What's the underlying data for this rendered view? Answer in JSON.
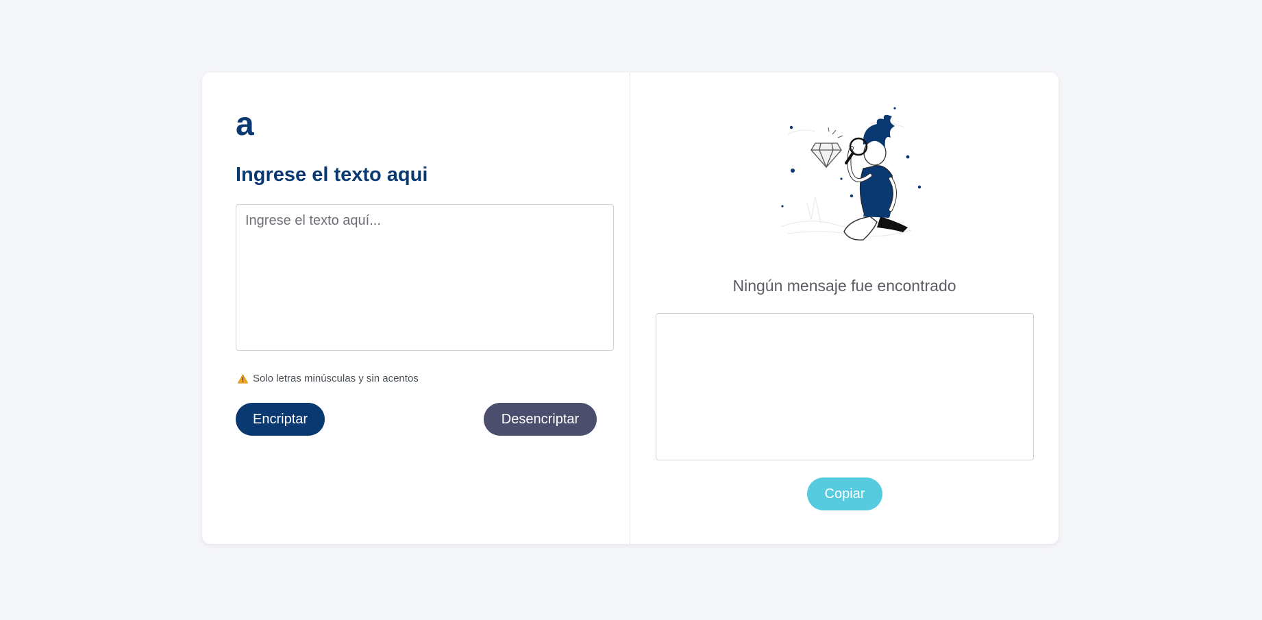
{
  "app": {
    "logo_text": "a",
    "heading": "Ingrese el texto aqui"
  },
  "input": {
    "placeholder": "Ingrese el texto aquí...",
    "value": ""
  },
  "hint": {
    "icon": "warning-icon",
    "text": "Solo letras minúsculas y sin acentos"
  },
  "buttons": {
    "encrypt_label": "Encriptar",
    "decrypt_label": "Desencriptar",
    "copy_label": "Copiar"
  },
  "output": {
    "empty_message": "Ningún mensaje fue encontrado",
    "value": ""
  },
  "colors": {
    "primary": "#0a3871",
    "secondary": "#4b4e6d",
    "copy": "#56cadf",
    "background": "#f5f6fa"
  }
}
